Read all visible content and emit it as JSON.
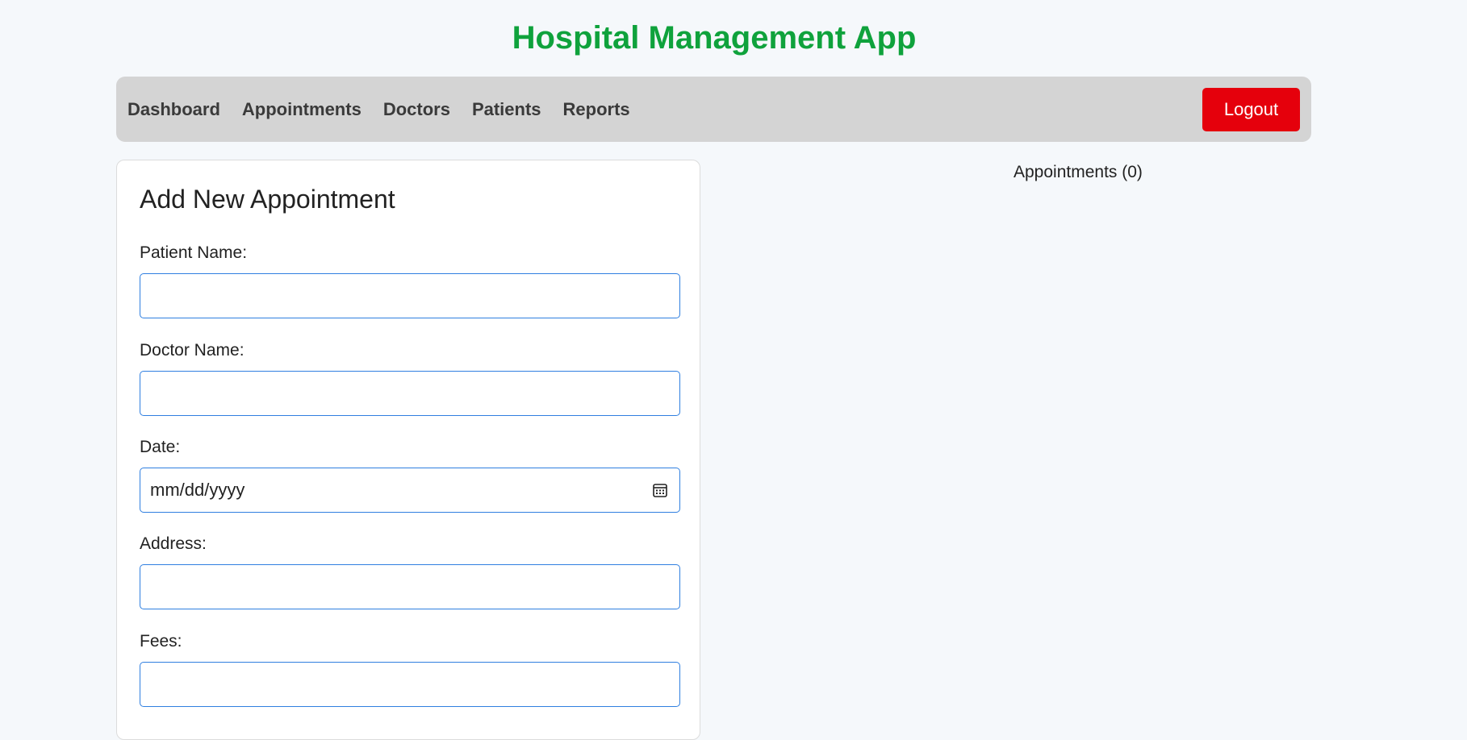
{
  "app": {
    "title": "Hospital Management App"
  },
  "nav": {
    "items": [
      {
        "label": "Dashboard"
      },
      {
        "label": "Appointments"
      },
      {
        "label": "Doctors"
      },
      {
        "label": "Patients"
      },
      {
        "label": "Reports"
      }
    ],
    "logout_label": "Logout"
  },
  "form": {
    "title": "Add New Appointment",
    "patient_name": {
      "label": "Patient Name:",
      "value": ""
    },
    "doctor_name": {
      "label": "Doctor Name:",
      "value": ""
    },
    "date": {
      "label": "Date:",
      "placeholder": "mm/dd/yyyy",
      "icon": "calendar-icon"
    },
    "address": {
      "label": "Address:",
      "value": ""
    },
    "fees": {
      "label": "Fees:",
      "value": ""
    }
  },
  "appointments": {
    "heading": "Appointments (0)"
  },
  "colors": {
    "title": "#0fa23c",
    "navbar_bg": "#d4d4d4",
    "logout_bg": "#e5000c",
    "input_border": "#2f7fe0",
    "page_bg": "#f5f8fb"
  }
}
